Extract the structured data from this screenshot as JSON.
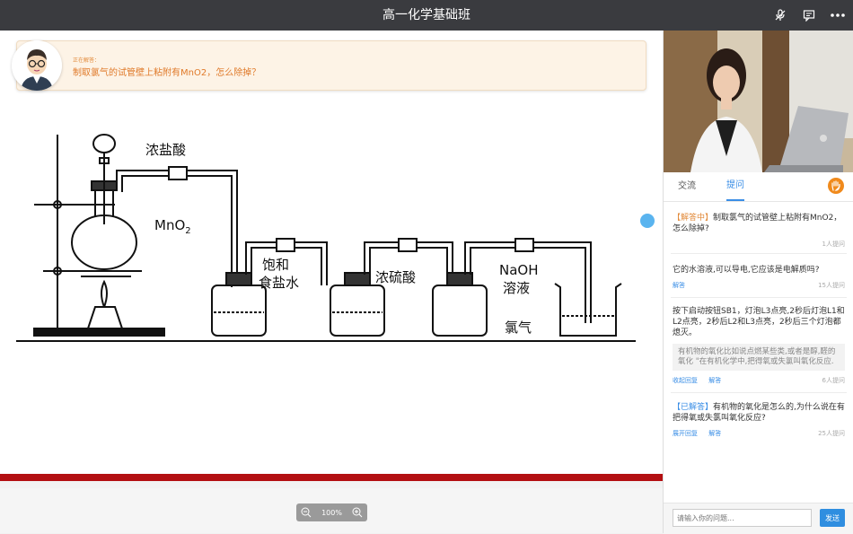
{
  "titlebar": {
    "title": "高一化学基础班"
  },
  "answering": {
    "tag": "正在解答：",
    "question": "制取氯气的试管壁上粘附有MnO2，怎么除掉？"
  },
  "diagram": {
    "labels": {
      "hcl": "浓盐酸",
      "mno2": "MnO",
      "mno2_sub": "2",
      "saturated": "饱和",
      "brine": "食盐水",
      "h2so4": "浓硫酸",
      "naoh": "NaOH",
      "solution": "溶液",
      "chlorine": "氯气"
    }
  },
  "zoom": {
    "level": "100%"
  },
  "panel": {
    "tabs": [
      "交流",
      "提问"
    ],
    "active_tab": "提问",
    "questions": [
      {
        "status": "【解答中】",
        "text": "制取氯气的试管壁上粘附有MnO2，怎么除掉?",
        "actions": [],
        "count": "1人提问"
      },
      {
        "status": "",
        "text": "它的水溶液,可以导电,它应该是电解质吗?",
        "actions": [
          "解答"
        ],
        "count": "15人提问"
      },
      {
        "status": "",
        "text": "按下启动按钮SB1，灯泡L3点亮,2秒后灯泡L1和L2点亮，2秒后L2和L3点亮，2秒后三个灯泡都熄灭。",
        "answer": "有机物的氧化比如说点燃某些类,或者是醇,醛的氧化 \"在有机化学中,把得氧或失氯叫氧化反应.",
        "actions": [
          "收起回复",
          "解答"
        ],
        "count": "6人提问"
      },
      {
        "status": "【已解答】",
        "text": "有机物的氧化是怎么的,为什么说在有把得氧或失氯叫氧化反应?",
        "actions": [
          "展开回复",
          "解答"
        ],
        "count": "25人提问"
      }
    ],
    "input_placeholder": "请输入你的问题...",
    "send_label": "发送"
  }
}
